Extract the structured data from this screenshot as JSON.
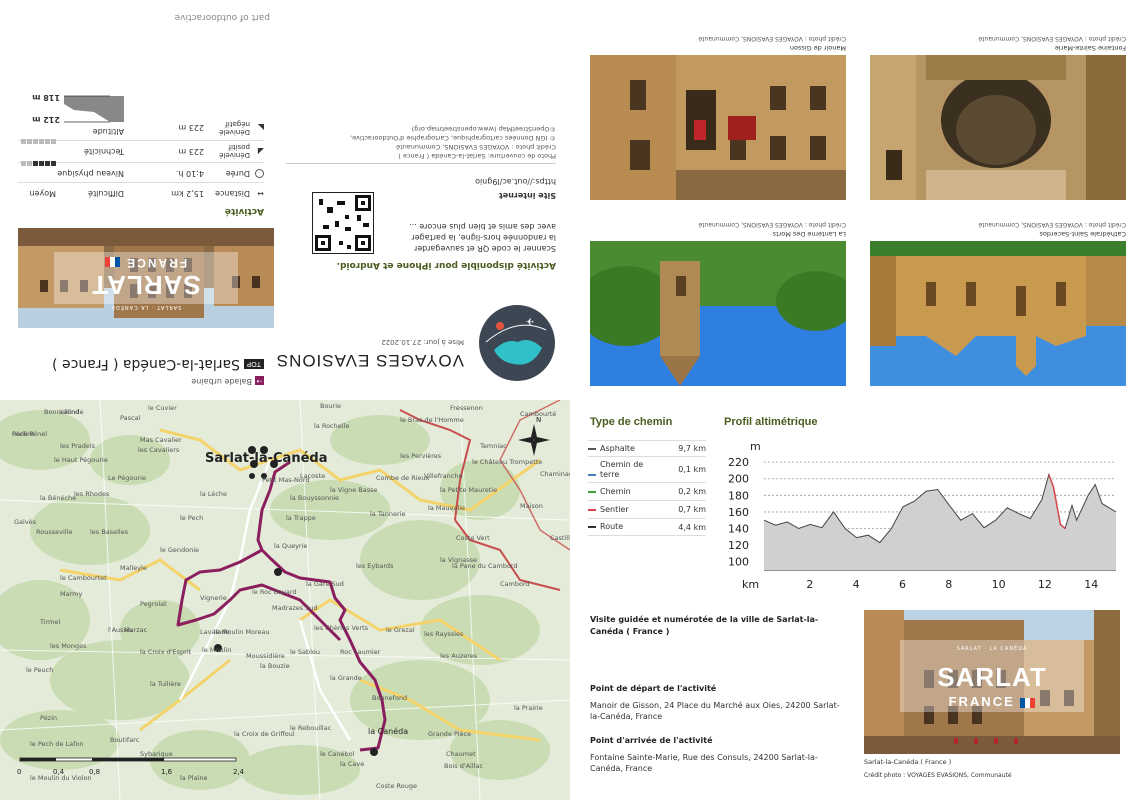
{
  "front": {
    "category": "Balade urbaine",
    "top_badge": "TOP",
    "title": "Sarlat-la-Canéda ( France )",
    "brand": "VOYAGES EVASIONS",
    "update": "Mise à jour: 27.10.2022",
    "app_heading": "Activité disponible pour iPhone et Android.",
    "app_text": "Scanner le code QR et sauvegarder la randonnée hors-ligne, la partager avec des amis et bien plus encore ...",
    "site_label": "Site internet",
    "site_url": "https://out.ac/l9gnio",
    "credits_1": "Photo de couverture: Sarlat-la-Canéda ( France )",
    "credits_2": "Crédit photo : VOYAGES EVASIONS, Communauté",
    "credits_3": "© IGN Données cartographique, Cartographie d'Outdooractive,",
    "credits_4": "©OpenStreetMap (www.openstreetmap.org)",
    "part_of": "part of outdooractive",
    "cover_city": "SARLAT",
    "cover_country": "FRANCE",
    "cover_small": "SARLAT · LA CANÉDA"
  },
  "activity": {
    "heading": "Activité",
    "stats": [
      {
        "label": "Difficulté",
        "value": "Moyen"
      },
      {
        "label": "Distance",
        "value": "15,2 km"
      },
      {
        "label": "Niveau physique",
        "value": ""
      },
      {
        "label": "Durée",
        "value": "4:10 h."
      },
      {
        "label": "Technicité",
        "value": ""
      },
      {
        "label": "Dénivelé positif",
        "value": "223 m"
      },
      {
        "label": "Altitude",
        "value": ""
      },
      {
        "label": "Dénivelé négatif",
        "value": "223 m"
      }
    ],
    "alt_max": "212 m",
    "alt_min": "118 m",
    "physical_level": 4,
    "technique_level": 0
  },
  "photos": [
    {
      "caption": "Manoir de Gisson",
      "credit": "Crédit photo : VOYAGES EVASIONS, Communauté"
    },
    {
      "caption": "Fontaine Sainte-Marie",
      "credit": "Crédit photo : VOYAGES EVASIONS, Communauté"
    },
    {
      "caption": "La Lanterne Des Morts",
      "credit": "Crédit photo : VOYAGES EVASIONS, Communauté"
    },
    {
      "caption": "Cathédrale Saint-Sacerdos",
      "credit": "Crédit photo : VOYAGES EVASIONS, Communauté"
    }
  ],
  "map": {
    "town_main": "Sarlat-la-Canéda",
    "town_end": "la Canéda",
    "places": [
      "Pech Pénel",
      "Pascal",
      "le Cuvier",
      "Bonnefond",
      "Mas Cavalier",
      "les Pradels",
      "les Cavaliers",
      "le Haut Pégourie",
      "la Bénéche",
      "les Rhodes",
      "Le Pégourie",
      "la Lèche",
      "Petit Mas-Nord",
      "Lacoste",
      "la Bouyssonnie",
      "la Vigne Basse",
      "la Trappe",
      "Combe de Rieux",
      "Villefranche",
      "la Petite Mauretie",
      "Rousseville",
      "les Baselles",
      "le Pech",
      "la Tannerie",
      "la Mauvalie",
      "Galvès",
      "le Gendonie",
      "la Queyrie",
      "Coste Vert",
      "la Vignasse",
      "Malleyle",
      "la Gare Sud",
      "les Eybards",
      "la Pane du Cambord",
      "le Cambourtet",
      "Marmy",
      "Vignerie",
      "le Roc Bayard",
      "Madrazes Sud",
      "Cambord",
      "Tirmel",
      "Pegrolat",
      "Marzac",
      "le Grezal",
      "les Rayssies",
      "Lavalade",
      "l'Aussis",
      "le Moulin Moreau",
      "les Chènes Verts",
      "les Monges",
      "la Croix d'Esprit",
      "le Moulin",
      "Moussidière",
      "la Bouzie",
      "les Auzeres",
      "le Sablou",
      "Roc Laumier",
      "Pézin",
      "le Peuch",
      "la Grande",
      "la Tuilière",
      "le Pech de Lafon",
      "Grande Pièce",
      "le Canébol",
      "Chaumet",
      "Bois d'Aillac",
      "la Cave",
      "Coste Rouge",
      "la Plaine",
      "Boutifarc",
      "Sybarique",
      "Bonnefond",
      "la Prairie",
      "le Rebouillac",
      "la Croix de Griffoul",
      "le Moulin du Violon",
      "Lalinde",
      "Fressenon",
      "le Bras de l'Homme",
      "Bourie",
      "la Rochelle",
      "les Pervières",
      "le Château Trompette",
      "Cambourté",
      "Temniac",
      "Chaminade",
      "Maison",
      "Castillou",
      "Rivière"
    ],
    "scale": [
      "0",
      "0,4",
      "0,8",
      "1,6",
      "2,4"
    ]
  },
  "route_types": {
    "heading": "Type de chemin",
    "rows": [
      {
        "name": "Asphalte",
        "value": "9,7 km",
        "color": "#555555"
      },
      {
        "name": "Chemin de terre",
        "value": "0,1 km",
        "color": "#4a7fc1"
      },
      {
        "name": "Chemin",
        "value": "0,2 km",
        "color": "#3da43d"
      },
      {
        "name": "Sentier",
        "value": "0,7 km",
        "color": "#d64545"
      },
      {
        "name": "Route",
        "value": "4,4 km",
        "color": "#333333"
      }
    ]
  },
  "chart_data": {
    "type": "area",
    "title": "Profil altimétrique",
    "xlabel": "km",
    "ylabel": "m",
    "x": [
      0,
      0.5,
      1,
      1.5,
      2,
      2.5,
      3,
      3.5,
      4,
      4.5,
      5,
      5.5,
      6,
      6.5,
      7,
      7.5,
      8,
      8.5,
      9,
      9.5,
      10,
      10.5,
      11,
      11.5,
      12,
      12.3,
      12.5,
      12.8,
      13,
      13.3,
      13.5,
      14,
      14.3,
      14.6,
      15.2
    ],
    "values": [
      150,
      144,
      148,
      140,
      145,
      141,
      160,
      140,
      129,
      132,
      123,
      140,
      166,
      173,
      185,
      187,
      168,
      150,
      158,
      141,
      150,
      165,
      158,
      152,
      175,
      205,
      190,
      145,
      140,
      168,
      150,
      180,
      193,
      170,
      160
    ],
    "xticks": [
      2,
      4,
      6,
      8,
      10,
      12,
      14
    ],
    "yticks": [
      100,
      120,
      140,
      160,
      180,
      200,
      220
    ],
    "xlim": [
      0,
      15.2
    ],
    "ylim": [
      90,
      225
    ],
    "grid": true
  },
  "info": {
    "description": "Visite guidée et numérotée de la ville de Sarlat-la-Canéda ( France )",
    "start_heading": "Point de départ de l'activité",
    "start_text": "Manoir de Gisson, 24 Place du Marché aux Oies, 24200 Sarlat-la-Canéda, France",
    "end_heading": "Point d'arrivée de l'activité",
    "end_text": "Fontaine Sainte-Marie, Rue des Consuls, 24200 Sarlat-la-Canéda, France",
    "thumb_caption": "Sarlat-la-Canéda ( France )",
    "thumb_credit": "Crédit photo : VOYAGES EVASIONS, Communauté",
    "thumb_city": "SARLAT",
    "thumb_country": "FRANCE",
    "thumb_small": "SARLAT · LA CANÉDA"
  },
  "colors": {
    "accent_green": "#4a5c1f",
    "route": "#8b1e5e",
    "profile_fill": "#d0d0d0"
  }
}
